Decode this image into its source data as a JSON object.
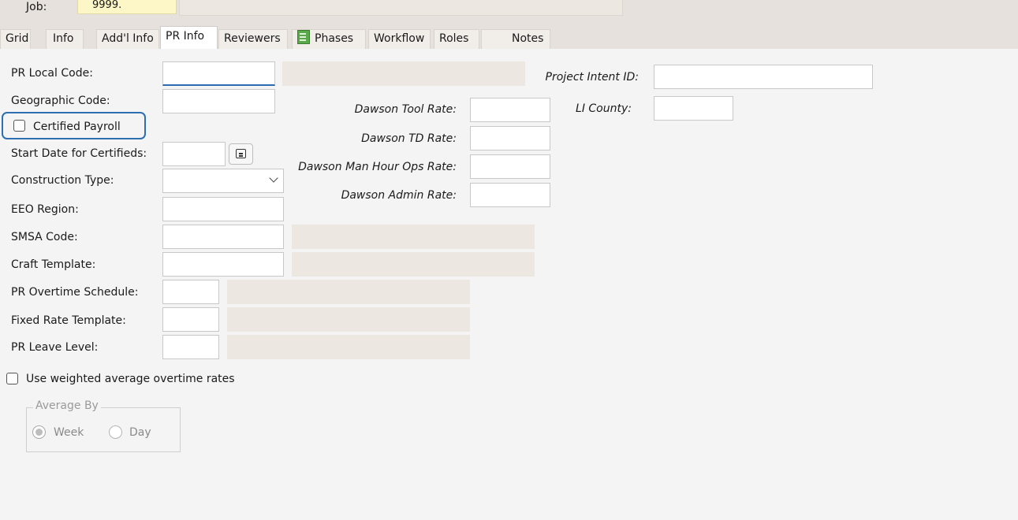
{
  "header": {
    "job_label": "Job:",
    "job_value": "9999."
  },
  "tabs": [
    {
      "label": "Grid"
    },
    {
      "label": "Info"
    },
    {
      "label": "Add'l Info"
    },
    {
      "label": "PR Info"
    },
    {
      "label": "Reviewers"
    },
    {
      "label": "Phases"
    },
    {
      "label": "Workflow"
    },
    {
      "label": "Roles"
    },
    {
      "label": "Notes"
    }
  ],
  "active_tab": "PR Info",
  "form": {
    "pr_local_code": "PR Local Code:",
    "geographic_code": "Geographic Code:",
    "certified_payroll": "Certified Payroll",
    "start_date": "Start Date for Certifieds:",
    "construction_type": "Construction Type:",
    "eeo_region": "EEO Region:",
    "smsa_code": "SMSA Code:",
    "craft_template": "Craft Template:",
    "pr_overtime_schedule": "PR Overtime Schedule:",
    "fixed_rate_template": "Fixed Rate Template:",
    "pr_leave_level": "PR Leave Level:",
    "use_weighted": "Use weighted average overtime rates",
    "average_by": "Average By",
    "week": "Week",
    "day": "Day",
    "dawson_tool_rate": "Dawson Tool Rate:",
    "dawson_td_rate": "Dawson TD Rate:",
    "dawson_man_hour": "Dawson Man Hour Ops Rate:",
    "dawson_admin_rate": "Dawson Admin Rate:",
    "project_intent_id": "Project Intent ID:",
    "li_county": "LI County:"
  },
  "colors": {
    "accent": "#2d6fb0",
    "readonly": "#ece7e1",
    "job_value_bg": "#fdf6c6"
  }
}
